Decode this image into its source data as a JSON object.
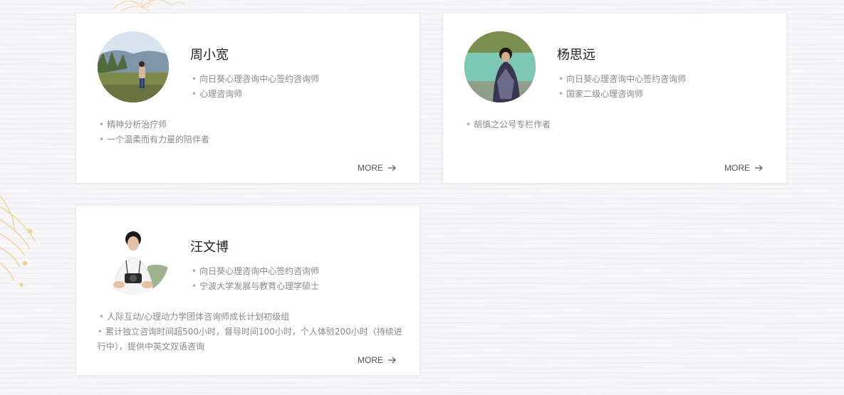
{
  "cards": [
    {
      "name": "周小宽",
      "titles": [
        "向日葵心理咨询中心签约咨询师",
        "心理咨询师"
      ],
      "desc": [
        "精神分析治疗师",
        "一个温柔而有力量的陪伴者"
      ],
      "more": "MORE"
    },
    {
      "name": "杨思远",
      "titles": [
        "向日葵心理咨询中心签约咨询师",
        "国家二级心理咨询师"
      ],
      "desc": [
        "胡慎之公号专栏作者"
      ],
      "more": "MORE"
    },
    {
      "name": "汪文博",
      "titles": [
        "向日葵心理咨询中心签约咨询师",
        "宁波大学发展与教育心理学硕士"
      ],
      "desc": [
        "人际互动/心理动力学团体咨询师成长计划初级组",
        "累计独立咨询时间超500小时，督导时间100小时，个人体验200小时（持续进行中），提供中英文双语咨询"
      ],
      "more": "MORE"
    }
  ],
  "colors": {
    "accent_deco": "#f0c97a",
    "text_main": "#222222",
    "text_muted": "#8a8a8a"
  },
  "icons": {
    "more": "arrow-right-icon"
  }
}
